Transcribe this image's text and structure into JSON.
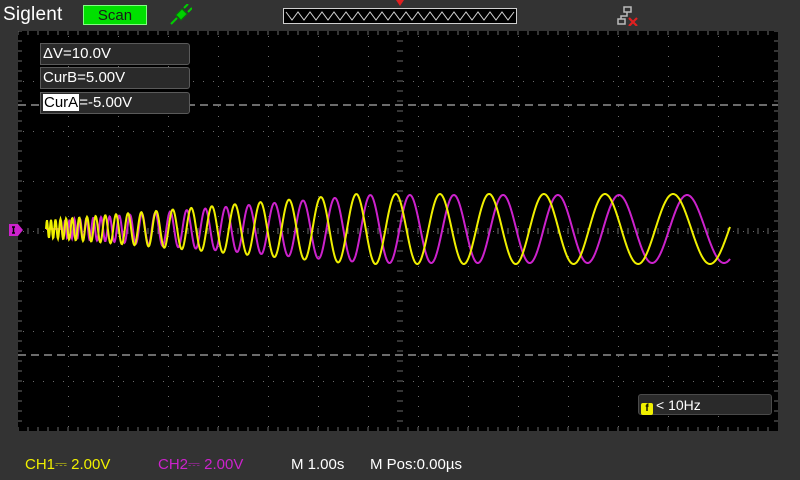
{
  "header": {
    "brand": "Siglent",
    "mode": "Scan",
    "probe_icon": "probe-icon",
    "network_icon": "network-disconnected-icon"
  },
  "cursors": {
    "delta": "ΔV=10.0V",
    "cur_b": "CurB=5.00V",
    "cur_a_label": "CurA",
    "cur_a_value": "=-5.00V"
  },
  "frequency": {
    "icon_glyph": "f",
    "value": "< 10Hz"
  },
  "status": {
    "ch1": "CH1⎓ 2.00V",
    "ch2": "CH2⎓ 2.00V",
    "timebase": "M 1.00s",
    "mpos": "M Pos:0.00µs"
  },
  "colors": {
    "ch1": "#f0f000",
    "ch2": "#cc22cc",
    "mode_badge": "#00e000",
    "screen_bg": "#000000"
  }
}
